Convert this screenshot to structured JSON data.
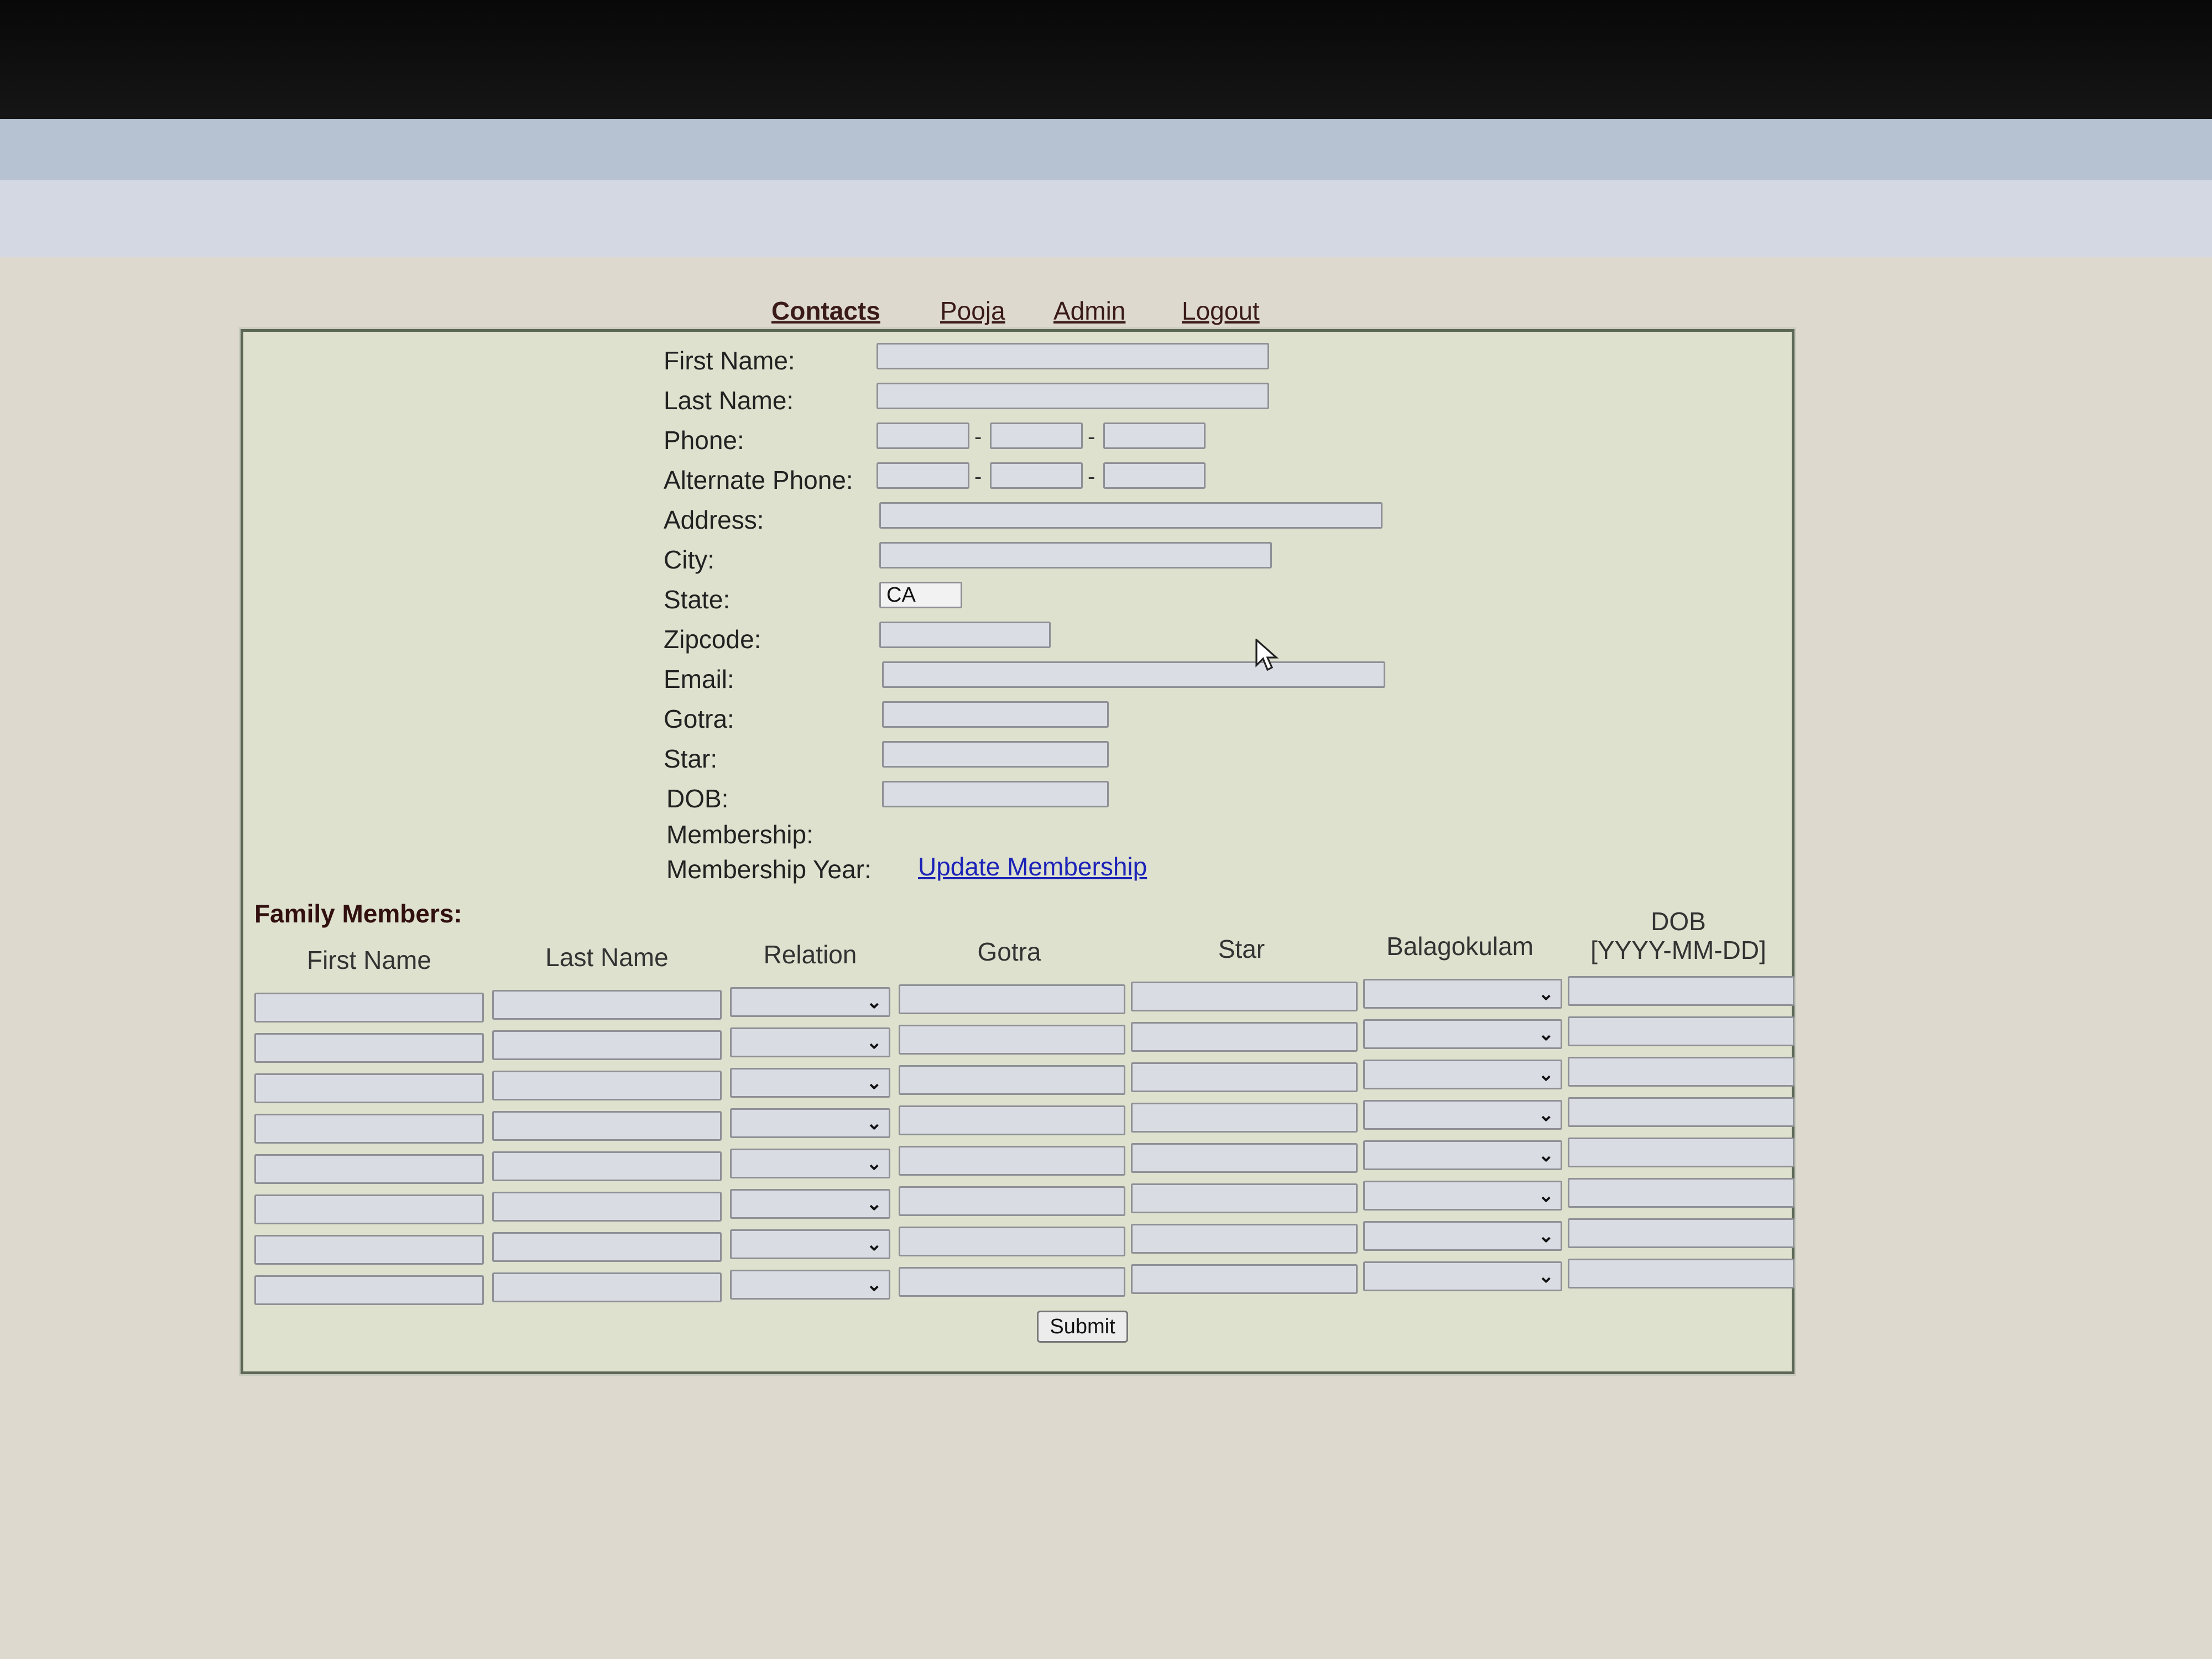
{
  "nav": {
    "contacts": "Contacts",
    "pooja": "Pooja",
    "admin": "Admin",
    "logout": "Logout"
  },
  "form": {
    "first_name_label": "First Name:",
    "last_name_label": "Last Name:",
    "phone_label": "Phone:",
    "alt_phone_label": "Alternate Phone:",
    "address_label": "Address:",
    "city_label": "City:",
    "state_label": "State:",
    "state_value": "CA",
    "zipcode_label": "Zipcode:",
    "email_label": "Email:",
    "gotra_label": "Gotra:",
    "star_label": "Star:",
    "dob_label": "DOB:",
    "membership_label": "Membership:",
    "membership_year_label": "Membership Year:",
    "update_membership_link": "Update Membership",
    "phone_separator": "-"
  },
  "family": {
    "title": "Family Members:",
    "columns": {
      "first_name": "First Name",
      "last_name": "Last Name",
      "relation": "Relation",
      "gotra": "Gotra",
      "star": "Star",
      "balagokulam": "Balagokulam",
      "dob_line1": "DOB",
      "dob_line2": "[YYYY-MM-DD]"
    },
    "row_count": 8
  },
  "submit_label": "Submit",
  "icons": {
    "dropdown": "chevron-down-icon",
    "cursor": "mouse-pointer-icon"
  }
}
